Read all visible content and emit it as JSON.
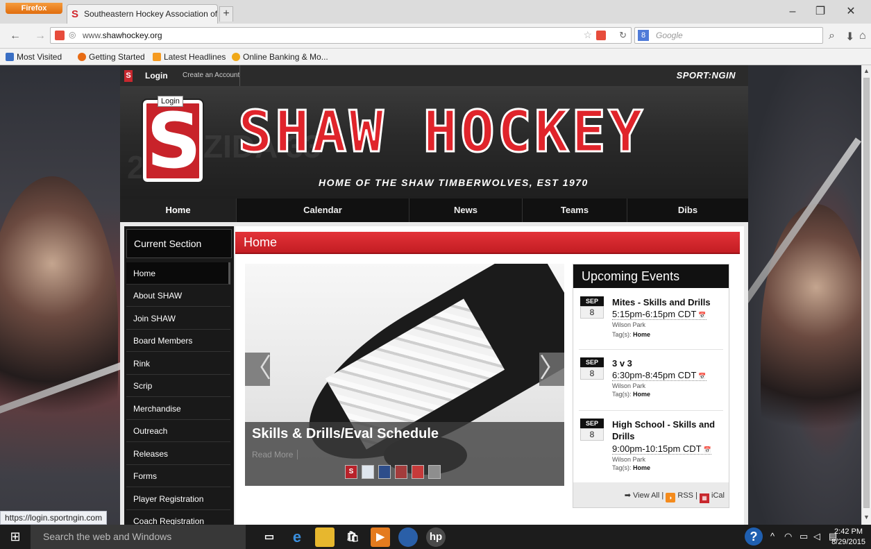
{
  "browser": {
    "menu_label": "Firefox",
    "tab_title": "Southeastern Hockey Association of Wis...",
    "new_tab": "+",
    "url_host": "www.",
    "url_domain": "shawhockey.org",
    "search_placeholder": "Google",
    "window_min": "–",
    "window_max": "❐",
    "window_close": "✕",
    "bookmarks": [
      {
        "label": "Most Visited",
        "color": "#3a6fc4"
      },
      {
        "label": "Getting Started",
        "color": "#e76b14"
      },
      {
        "label": "Latest Headlines",
        "color": "#f59a20"
      },
      {
        "label": "Online Banking & Mo...",
        "color": "#f0a818"
      }
    ]
  },
  "site": {
    "logo_letter": "S",
    "login": "Login",
    "create_account": "Create an Account",
    "sportngin": "SPORT:NGIN",
    "tooltip": "Login",
    "banner_letter": "S",
    "banner_title": "SHAW HOCKEY",
    "banner_sub": "HOME OF THE SHAW TIMBERWOLVES, EST 1970",
    "nav": [
      {
        "label": "Home"
      },
      {
        "label": "Calendar"
      },
      {
        "label": "News"
      },
      {
        "label": "Teams"
      },
      {
        "label": "Dibs"
      }
    ],
    "sidebar_title": "Current Section",
    "sidebar_items": [
      {
        "label": "Home"
      },
      {
        "label": "About SHAW"
      },
      {
        "label": "Join SHAW"
      },
      {
        "label": "Board Members"
      },
      {
        "label": "Rink"
      },
      {
        "label": "Scrip"
      },
      {
        "label": "Merchandise"
      },
      {
        "label": "Outreach"
      },
      {
        "label": "Releases"
      },
      {
        "label": "Forms"
      },
      {
        "label": "Player Registration"
      },
      {
        "label": "Coach Registration"
      }
    ],
    "section_title": "Home",
    "slider": {
      "prev": "〈",
      "next": "〉",
      "caption": "Skills & Drills/Eval Schedule",
      "read_more": "Read More"
    },
    "events_title": "Upcoming Events",
    "events": [
      {
        "month": "SEP",
        "day": "8",
        "title": "Mites - Skills and Drills",
        "time": "5:15pm-6:15pm CDT",
        "location": "Wilson Park",
        "tags_label": "Tag(s):",
        "tags": "Home"
      },
      {
        "month": "SEP",
        "day": "8",
        "title": "3 v 3",
        "time": "6:30pm-8:45pm CDT",
        "location": "Wilson Park",
        "tags_label": "Tag(s):",
        "tags": "Home"
      },
      {
        "month": "SEP",
        "day": "8",
        "title": "High School - Skills and Drills",
        "time": "9:00pm-10:15pm CDT",
        "location": "Wilson Park",
        "tags_label": "Tag(s):",
        "tags": "Home"
      }
    ],
    "view_all": "View All",
    "rss": "RSS",
    "ical": "iCal"
  },
  "status_url": "https://login.sportngin.com",
  "taskbar": {
    "search_placeholder": "Search the web and Windows",
    "time": "2:42 PM",
    "date": "8/29/2015"
  }
}
